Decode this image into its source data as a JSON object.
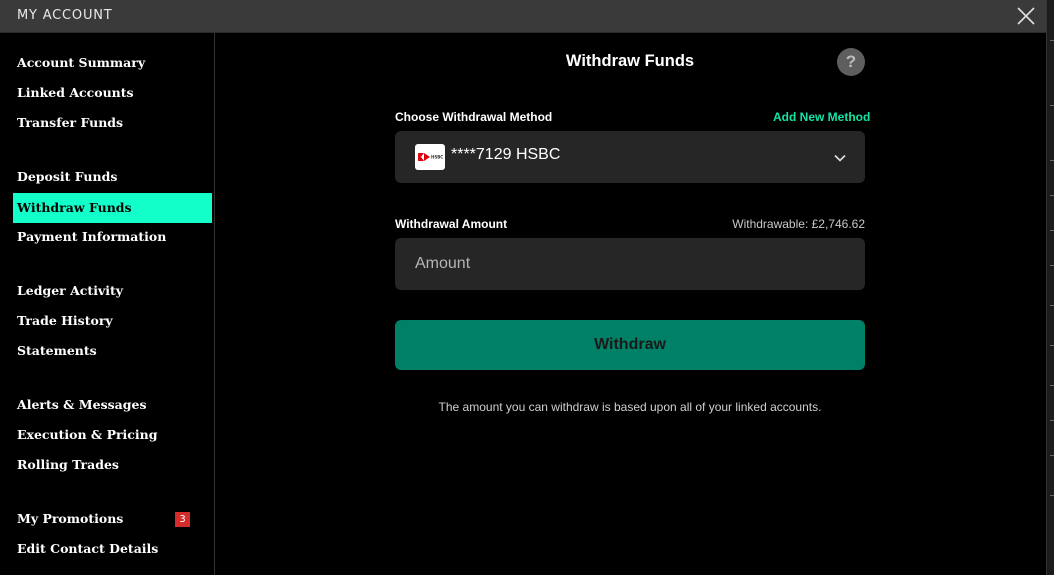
{
  "window": {
    "title": "MY ACCOUNT"
  },
  "sidebar": {
    "items": [
      {
        "label": "Account Summary",
        "active": false
      },
      {
        "label": "Linked Accounts",
        "active": false
      },
      {
        "label": "Transfer Funds",
        "active": false
      },
      {
        "label": "Deposit Funds",
        "active": false
      },
      {
        "label": "Withdraw Funds",
        "active": true
      },
      {
        "label": "Payment Information",
        "active": false
      },
      {
        "label": "Ledger Activity",
        "active": false
      },
      {
        "label": "Trade History",
        "active": false
      },
      {
        "label": "Statements",
        "active": false
      },
      {
        "label": "Alerts & Messages",
        "active": false
      },
      {
        "label": "Execution & Pricing",
        "active": false
      },
      {
        "label": "Rolling Trades",
        "active": false
      },
      {
        "label": "My Promotions",
        "active": false,
        "badge": "3"
      },
      {
        "label": "Edit Contact Details",
        "active": false
      }
    ]
  },
  "main": {
    "title": "Withdraw Funds",
    "help_label": "?",
    "method": {
      "label": "Choose Withdrawal Method",
      "add_new_label": "Add New Method",
      "selected": "****7129 HSBC",
      "bank_logo_text": "HSBC"
    },
    "amount": {
      "label": "Withdrawal Amount",
      "withdrawable": "Withdrawable: £2,746.62",
      "placeholder": "Amount",
      "value": ""
    },
    "withdraw_button": "Withdraw",
    "note": "The amount you can withdraw is based upon all of your linked accounts."
  },
  "colors": {
    "accent": "#12ffc9",
    "link": "#12e3a6",
    "button": "#008066",
    "badge": "#d52b2b",
    "hsbc_red": "#db0011"
  },
  "icons": {
    "close": "close-icon",
    "help": "help-icon",
    "bank": "hsbc-logo-icon",
    "dropdown": "chevron-down-icon"
  }
}
